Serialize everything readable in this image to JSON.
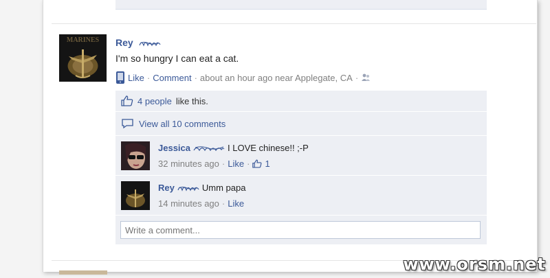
{
  "post": {
    "author": "Rey",
    "text": "I'm so hungry I can eat a cat.",
    "actions": {
      "like": "Like",
      "comment": "Comment",
      "time_location": "about an hour ago near Applegate, CA"
    },
    "avatar_caption": "MARINES"
  },
  "ufi": {
    "likes_count": "4 people",
    "likes_suffix": "like this.",
    "view_all": "View all 10 comments",
    "comments": [
      {
        "author": "Jessica",
        "text": "I LOVE chinese!! ;-P",
        "time": "32 minutes ago",
        "like": "Like",
        "like_count": "1"
      },
      {
        "author": "Rey",
        "text": "Umm papa",
        "time": "14 minutes ago",
        "like": "Like"
      }
    ],
    "input_placeholder": "Write a comment..."
  },
  "watermark": "www.orsm.net",
  "colors": {
    "link": "#3b5998",
    "ufi_bg": "#edeff4",
    "input_border": "#bdc7d8"
  }
}
